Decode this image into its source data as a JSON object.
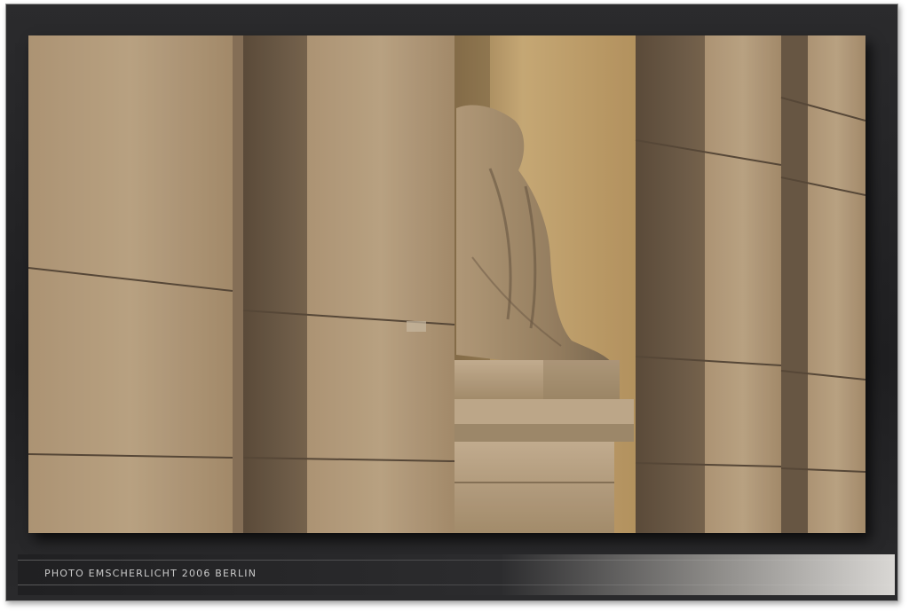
{
  "photo": {
    "subject": "stone-columns-with-draped-statue"
  },
  "caption": {
    "text": "PHOTO EMSCHERLICHT 2006 BERLIN"
  },
  "colors": {
    "frame": "#232325",
    "stone_light": "#b8a07f",
    "stone_shadow": "#6f5d48",
    "niche_wall": "#c9a86f"
  }
}
